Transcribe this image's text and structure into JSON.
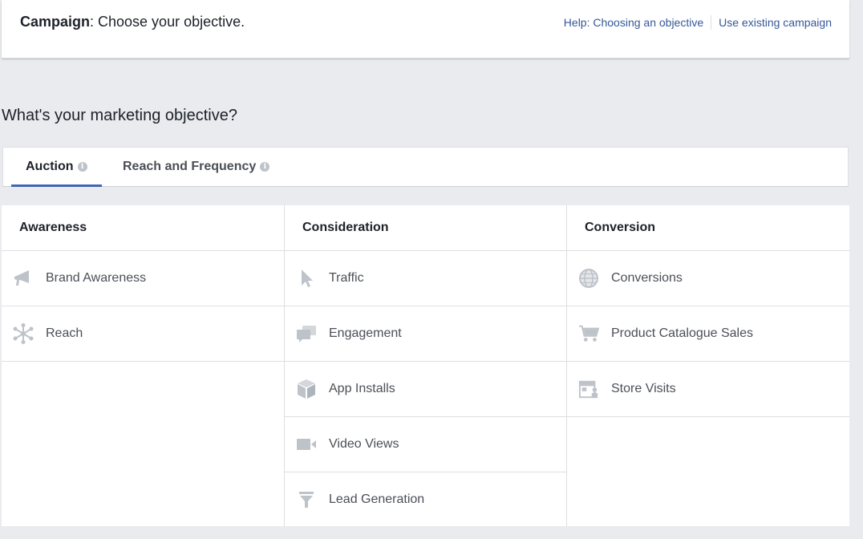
{
  "header": {
    "title_strong": "Campaign",
    "title_rest": ": Choose your objective.",
    "help_link": "Help: Choosing an objective",
    "existing_link": "Use existing campaign"
  },
  "section_title": "What's your marketing objective?",
  "tabs": [
    {
      "label": "Auction",
      "active": true
    },
    {
      "label": "Reach and Frequency",
      "active": false
    }
  ],
  "columns": [
    {
      "title": "Awareness",
      "items": [
        {
          "label": "Brand Awareness",
          "icon": "megaphone-icon"
        },
        {
          "label": "Reach",
          "icon": "reach-icon"
        }
      ]
    },
    {
      "title": "Consideration",
      "items": [
        {
          "label": "Traffic",
          "icon": "cursor-icon"
        },
        {
          "label": "Engagement",
          "icon": "chat-icon"
        },
        {
          "label": "App Installs",
          "icon": "box-icon"
        },
        {
          "label": "Video Views",
          "icon": "video-camera-icon"
        },
        {
          "label": "Lead Generation",
          "icon": "funnel-icon"
        }
      ]
    },
    {
      "title": "Conversion",
      "items": [
        {
          "label": "Conversions",
          "icon": "globe-icon"
        },
        {
          "label": "Product Catalogue Sales",
          "icon": "cart-icon"
        },
        {
          "label": "Store Visits",
          "icon": "store-icon"
        }
      ]
    }
  ],
  "colors": {
    "icon": "#bec3c9",
    "link": "#365899",
    "tab_indicator": "#4267b2",
    "background": "#e9ebee"
  }
}
